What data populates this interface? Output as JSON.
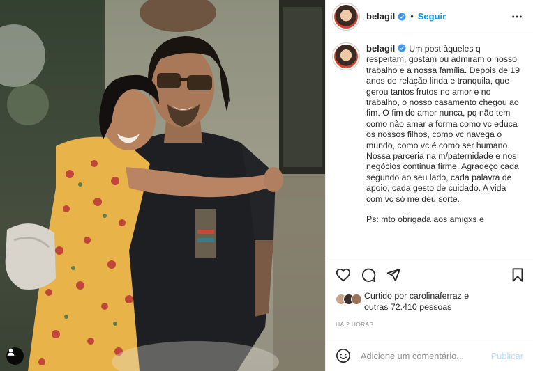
{
  "post": {
    "username": "belagil",
    "separator": "•",
    "follow_label": "Seguir",
    "caption": "Um post àqueles q respeitam, gostam ou admiram o nosso trabalho e a nossa família. Depois de 19 anos de relação linda e tranquila, que gerou tantos frutos no amor e no trabalho, o nosso casamento chegou ao fim. O fim do amor nunca, pq não tem como não amar a forma como vc educa os nossos filhos, como vc navega o mundo, como vc é como ser humano. Nossa parceria na m/paternidade e nos negócios continua firme. Agradeço cada segundo ao seu lado, cada palavra de apoio, cada gesto de cuidado. A vida com vc só me deu sorte.",
    "caption_ps": "Ps: mto obrigada aos amigxs e"
  },
  "likes": {
    "line1": "Curtido por carolinaferraz e",
    "line2": "outras 72.410 pessoas"
  },
  "timestamp": "HÁ 2 HORAS",
  "comment": {
    "placeholder": "Adicione um comentário...",
    "publish_label": "Publicar"
  },
  "icons": {
    "verified": "verified-badge-icon",
    "more": "more-options-icon",
    "like": "heart-icon",
    "comment": "comment-icon",
    "share": "share-icon",
    "save": "bookmark-icon",
    "emoji": "emoji-icon",
    "user_tags": "user-tag-icon"
  },
  "colors": {
    "follow": "#0095f6",
    "verified": "#3897f0",
    "publish_disabled": "#b2dffc",
    "muted": "#8e8e8e"
  }
}
